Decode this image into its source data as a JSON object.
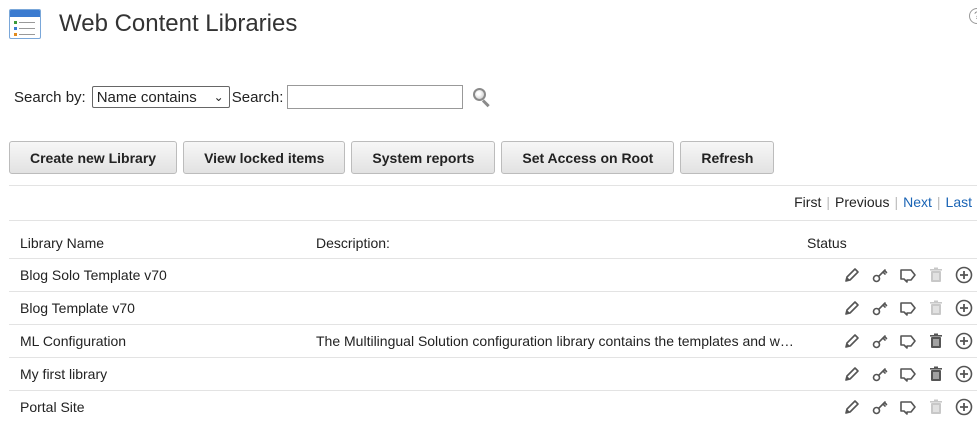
{
  "header": {
    "title": "Web Content Libraries",
    "help": "?"
  },
  "search": {
    "by_label": "Search by:",
    "selected": "Name contains",
    "search_label": "Search:",
    "value": ""
  },
  "toolbar": {
    "create": "Create new Library",
    "view_locked": "View locked items",
    "reports": "System reports",
    "set_access": "Set Access on Root",
    "refresh": "Refresh"
  },
  "pager": {
    "first": "First",
    "previous": "Previous",
    "next": "Next",
    "last": "Last"
  },
  "table": {
    "headers": {
      "name": "Library Name",
      "description": "Description:",
      "status": "Status"
    },
    "rows": [
      {
        "name": "Blog Solo Template v70",
        "description": "",
        "delete_enabled": false
      },
      {
        "name": "Blog Template v70",
        "description": "",
        "delete_enabled": false
      },
      {
        "name": "ML Configuration",
        "description": "The Multilingual Solution configuration library contains the templates and workflow",
        "delete_enabled": true
      },
      {
        "name": "My first library",
        "description": "",
        "delete_enabled": true
      },
      {
        "name": "Portal Site",
        "description": "",
        "delete_enabled": false
      }
    ]
  },
  "colors": {
    "link": "#1a64b5",
    "icon": "#555555",
    "icon_disabled": "#c8c8c8"
  }
}
